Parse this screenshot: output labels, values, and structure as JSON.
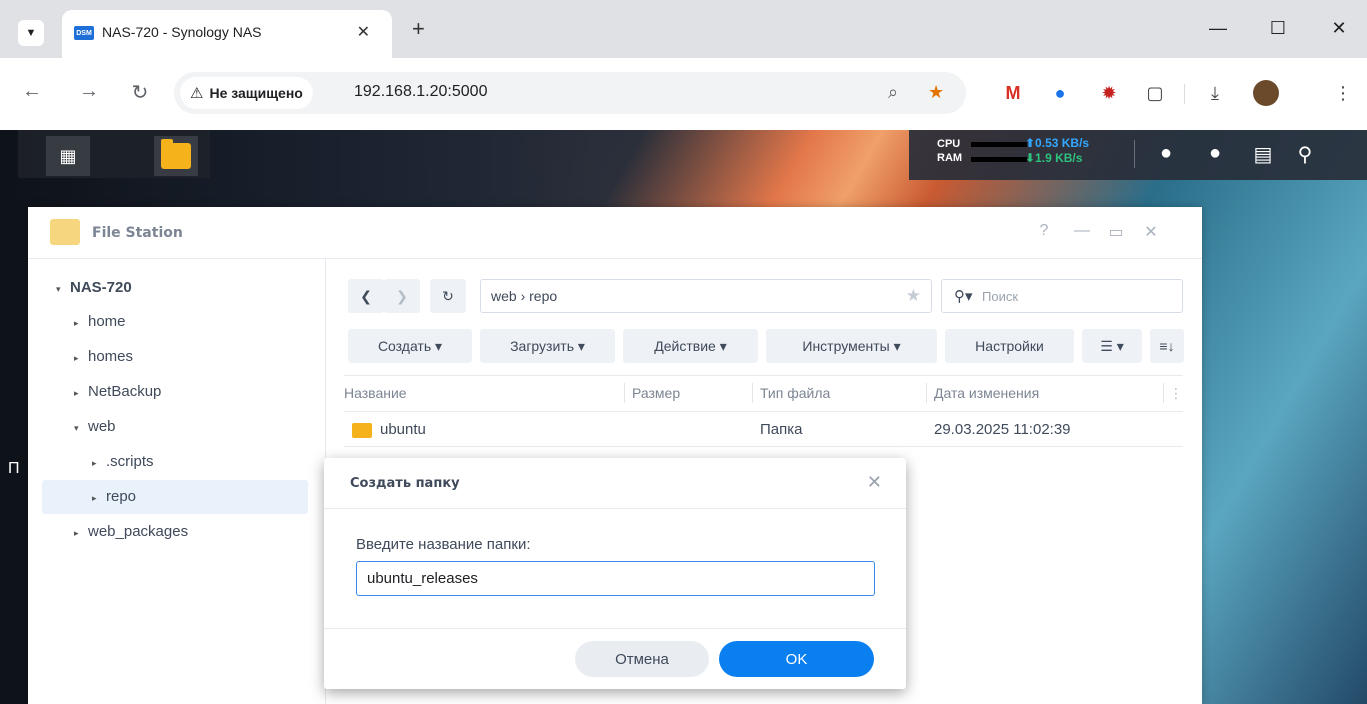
{
  "browser": {
    "tab_title": "NAS-720 - Synology NAS",
    "favicon_text": "DSM",
    "security_label": "Не защищено",
    "url": "192.168.1.20:5000"
  },
  "desktop": {
    "cpu_label": "CPU",
    "ram_label": "RAM",
    "upload_rate": "⬆0.53 KB/s",
    "download_rate": "⬇1.9 KB/s",
    "upload_color": "#33a7ff",
    "download_color": "#2ec27e",
    "partial_label": "П"
  },
  "file_station": {
    "title": "File Station",
    "tree": [
      {
        "label": "NAS-720",
        "arrow": "▾",
        "level": 0,
        "selected": false
      },
      {
        "label": "home",
        "arrow": "▸",
        "level": 1,
        "selected": false
      },
      {
        "label": "homes",
        "arrow": "▸",
        "level": 1,
        "selected": false
      },
      {
        "label": "NetBackup",
        "arrow": "▸",
        "level": 1,
        "selected": false
      },
      {
        "label": "web",
        "arrow": "▾",
        "level": 1,
        "selected": false
      },
      {
        "label": ".scripts",
        "arrow": "▸",
        "level": 2,
        "selected": false
      },
      {
        "label": "repo",
        "arrow": "▸",
        "level": 2,
        "selected": true
      },
      {
        "label": "web_packages",
        "arrow": "▸",
        "level": 1,
        "selected": false
      }
    ],
    "path": "web › repo",
    "search_placeholder": "Поиск",
    "toolbar": {
      "create": "Создать ▾",
      "upload": "Загрузить ▾",
      "action": "Действие ▾",
      "tools": "Инструменты ▾",
      "settings": "Настройки"
    },
    "columns": {
      "name": "Название",
      "size": "Размер",
      "type": "Тип файла",
      "modified": "Дата изменения"
    },
    "rows": [
      {
        "name": "ubuntu",
        "size": "",
        "type": "Папка",
        "modified": "29.03.2025 11:02:39"
      }
    ]
  },
  "dialog": {
    "title": "Создать папку",
    "label": "Введите название папки:",
    "input_value": "ubuntu_releases",
    "cancel": "Отмена",
    "ok": "OK",
    "ok_color": "#0a7ff0"
  }
}
